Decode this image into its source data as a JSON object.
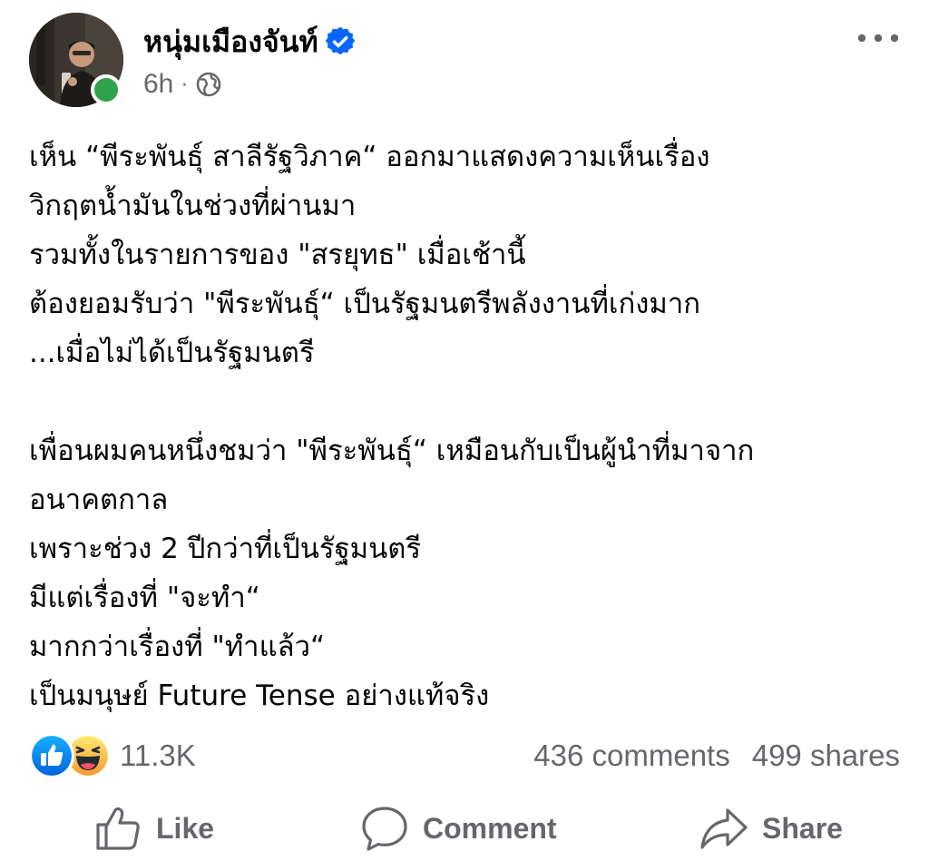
{
  "post": {
    "author": {
      "name": "หนุ่มเมืองจันท์",
      "verified_icon": "verified-badge-icon",
      "avatar": "profile-photo-avatar",
      "online_status_color": "#31a24c"
    },
    "meta": {
      "time": "6h",
      "separator": "·",
      "privacy_icon": "globe-icon"
    },
    "more_icon": "more-options-icon",
    "text_lines": [
      "เห็น “พีระพันธุ์  สาลีรัฐวิภาค“  ออกมาแสดงความเห็นเรื่อง",
      "วิกฤตน้ำมันในช่วงที่ผ่านมา",
      "รวมทั้งในรายการของ \"สรยุทธ\" เมื่อเช้านี้",
      "ต้องยอมรับว่า \"พีระพันธุ์“ เป็นรัฐมนตรีพลังงานที่เก่งมาก",
      "...เมื่อไม่ได้เป็นรัฐมนตรี",
      "",
      "เพื่อนผมคนหนึ่งชมว่า \"พีระพันธุ์“ เหมือนกับเป็นผู้นำที่มาจาก",
      "อนาคตกาล",
      "เพราะช่วง 2 ปีกว่าที่เป็นรัฐมนตรี",
      "มีแต่เรื่องที่ \"จะทำ“",
      "มากกว่าเรื่องที่ \"ทำแล้ว“",
      "เป็นมนุษย์ Future Tense อย่างแท้จริง"
    ],
    "stats": {
      "reaction_icons": [
        "like-reaction-icon",
        "haha-reaction-icon"
      ],
      "reaction_count": "11.3K",
      "comments": "436 comments",
      "shares": "499 shares"
    },
    "actions": {
      "like_label": "Like",
      "comment_label": "Comment",
      "share_label": "Share"
    },
    "colors": {
      "text_primary": "#050505",
      "text_secondary": "#65676b",
      "verified_blue": "#0866ff",
      "like_blue": "#1877f2",
      "haha_yellow": "#f7b125"
    }
  }
}
